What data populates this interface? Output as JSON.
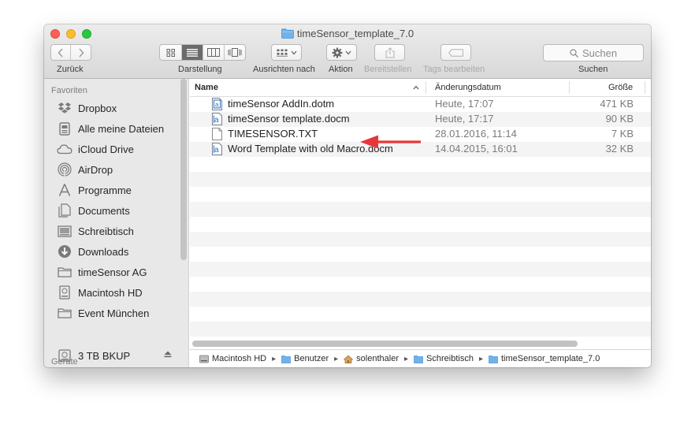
{
  "window": {
    "title": "timeSensor_template_7.0"
  },
  "toolbar": {
    "back_label": "Zurück",
    "view_label": "Darstellung",
    "arrange_label": "Ausrichten nach",
    "action_label": "Aktion",
    "share_label": "Bereitstellen",
    "tags_label": "Tags bearbeiten",
    "search_placeholder": "Suchen",
    "search_label": "Suchen"
  },
  "sidebar": {
    "favorites_header": "Favoriten",
    "items": [
      {
        "label": "Dropbox",
        "icon": "dropbox-icon"
      },
      {
        "label": "Alle meine Dateien",
        "icon": "all-files-icon"
      },
      {
        "label": "iCloud Drive",
        "icon": "cloud-icon"
      },
      {
        "label": "AirDrop",
        "icon": "airdrop-icon"
      },
      {
        "label": "Programme",
        "icon": "applications-icon"
      },
      {
        "label": "Documents",
        "icon": "documents-icon"
      },
      {
        "label": "Schreibtisch",
        "icon": "desktop-icon"
      },
      {
        "label": "Downloads",
        "icon": "downloads-icon"
      },
      {
        "label": "timeSensor AG",
        "icon": "folder-icon"
      },
      {
        "label": "Macintosh HD",
        "icon": "hard-drive-icon"
      },
      {
        "label": "Event München",
        "icon": "folder-icon"
      }
    ],
    "devices_header": "Geräte",
    "devices": [
      {
        "label": "3 TB BKUP",
        "icon": "hard-drive-icon"
      }
    ]
  },
  "columns": {
    "name": "Name",
    "date": "Änderungsdatum",
    "size": "Größe"
  },
  "files": [
    {
      "name": "timeSensor AddIn.dotm",
      "date": "Heute, 17:07",
      "size": "471 KB",
      "icon": "word-template-icon"
    },
    {
      "name": "timeSensor template.docm",
      "date": "Heute, 17:17",
      "size": "90 KB",
      "icon": "word-document-icon"
    },
    {
      "name": "TIMESENSOR.TXT",
      "date": "28.01.2016, 11:14",
      "size": "7 KB",
      "icon": "text-file-icon"
    },
    {
      "name": "Word Template with old Macro.docm",
      "date": "14.04.2015, 16:01",
      "size": "32 KB",
      "icon": "word-document-icon"
    }
  ],
  "pathbar": [
    {
      "label": "Macintosh HD",
      "icon": "hard-drive-icon"
    },
    {
      "label": "Benutzer",
      "icon": "folder-icon"
    },
    {
      "label": "solenthaler",
      "icon": "home-icon"
    },
    {
      "label": "Schreibtisch",
      "icon": "folder-icon"
    },
    {
      "label": "timeSensor_template_7.0",
      "icon": "folder-icon"
    }
  ],
  "colors": {
    "annotation_arrow": "#e8363a",
    "folder": "#6fb3ea"
  }
}
